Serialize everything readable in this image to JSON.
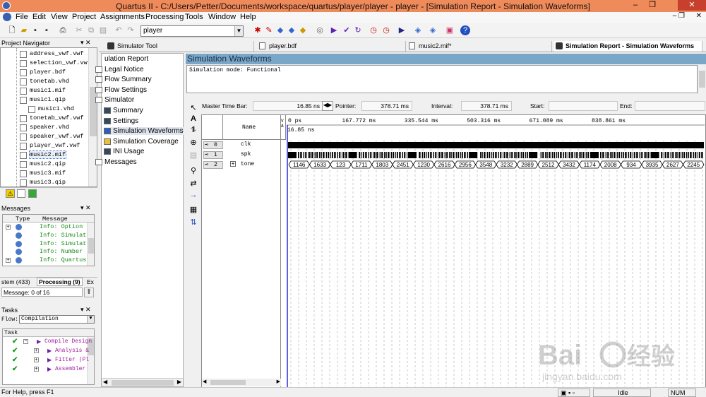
{
  "window": {
    "title": "Quartus II - C:/Users/Petter/Documents/workspace/quartus/player/player - player - [Simulation Report - Simulation Waveforms]"
  },
  "menu": [
    "File",
    "Edit",
    "View",
    "Project",
    "Assignments",
    "Processing",
    "Tools",
    "Window",
    "Help"
  ],
  "toolbar": {
    "entity_value": "player"
  },
  "navigator": {
    "title": "Project Navigator",
    "files": [
      {
        "name": "address_vwf.vwf",
        "indent": 0
      },
      {
        "name": "selection_vwf.vwf",
        "indent": 0
      },
      {
        "name": "player.bdf",
        "indent": 0
      },
      {
        "name": "tonetab.vhd",
        "indent": 0
      },
      {
        "name": "music1.mif",
        "indent": 0
      },
      {
        "name": "music1.qip",
        "indent": 0
      },
      {
        "name": "music1.vhd",
        "indent": 1
      },
      {
        "name": "tonetab_vwf.vwf",
        "indent": 0
      },
      {
        "name": "speaker.vhd",
        "indent": 0
      },
      {
        "name": "speaker_vwf.vwf",
        "indent": 0
      },
      {
        "name": "player_vwf.vwf",
        "indent": 0
      },
      {
        "name": "music2.mif",
        "indent": 0
      },
      {
        "name": "music2.qip",
        "indent": 0
      },
      {
        "name": "music3.mif",
        "indent": 0
      },
      {
        "name": "music3.qip",
        "indent": 0
      }
    ]
  },
  "messages": {
    "title": "Messages",
    "col_type": "Type",
    "col_message": "Message",
    "rows": [
      "Info: Option",
      "Info: Simulat",
      "Info: Simulat",
      "Info: Number",
      "Info: Quartus"
    ],
    "tabs": [
      "stem (433)",
      "Processing (9)",
      "Ex"
    ],
    "count": "Message: 0 of 16"
  },
  "tasks": {
    "title": "Tasks",
    "flow_label": "Flow:",
    "flow_value": "Compilation",
    "col_task": "Task",
    "rows": [
      "Compile Design",
      "Analysis &",
      "Fitter (Pl",
      "Assembler"
    ]
  },
  "report_tabs": [
    "Simulator Tool",
    "player.bdf",
    "music2.mif*",
    "Simulation Report - Simulation Waveforms"
  ],
  "report_tree": [
    "ulation Report",
    "Legal Notice",
    "Flow Summary",
    "Flow Settings",
    "Simulator",
    "Summary",
    "Settings",
    "Simulation Waveforms",
    "Simulation Coverage",
    "INI Usage",
    "Messages"
  ],
  "report": {
    "heading": "Simulation Waveforms",
    "mode": "Simulation mode: Functional"
  },
  "timebar": {
    "master_label": "Master Time Bar:",
    "master_value": "16.85 ns",
    "pointer_label": "Pointer:",
    "pointer_value": "378.71 ms",
    "interval_label": "Interval:",
    "interval_value": "378.71 ms",
    "start_label": "Start:",
    "end_label": "End:"
  },
  "waveform": {
    "name_header": "Name",
    "value_header": "V\nA",
    "time_ticks": [
      "0 ps",
      "167.772 ms",
      "335.544 ms",
      "503.316 ms",
      "671.089 ms",
      "838.861 ms"
    ],
    "marker": "16.85 ns",
    "signals": [
      {
        "idx": "0",
        "name": "clk"
      },
      {
        "idx": "1",
        "name": "spk"
      },
      {
        "idx": "2",
        "name": "tone"
      }
    ],
    "tone_values": [
      "1146",
      "1633",
      "123",
      "1711",
      "1803",
      "2451",
      "1230",
      "2616",
      "2956",
      "3548",
      "3232",
      "2889",
      "2512",
      "3432",
      "1174",
      "2008",
      "934",
      "3935",
      "2627",
      "2245"
    ]
  },
  "status": {
    "help": "For Help, press F1",
    "state": "Idle",
    "num": "NUM"
  },
  "colors": {
    "title_bg": "#ef8a5a",
    "heading_bg": "#7aa7c7",
    "cursor_blue": "#2a2ae0"
  }
}
